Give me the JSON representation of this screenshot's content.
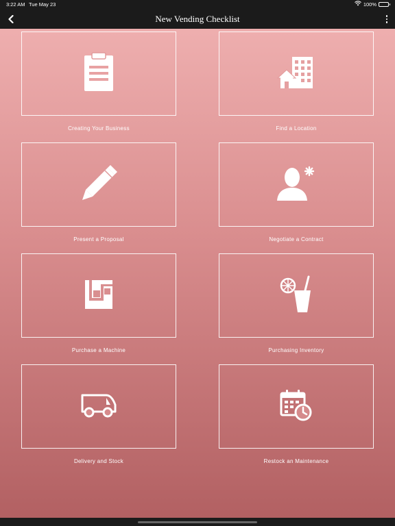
{
  "status_bar": {
    "time": "3:22 AM",
    "date": "Tue May 23",
    "battery": "100%",
    "battery_level": 1.0,
    "icons": [
      "wifi-icon",
      "battery-icon"
    ]
  },
  "nav": {
    "title": "New Vending Checklist",
    "back_icon": "chevron-left-icon",
    "more_icon": "more-vertical-icon"
  },
  "tiles": [
    {
      "label": "Creating Your Business",
      "icon": "clipboard-icon"
    },
    {
      "label": "Find a Location",
      "icon": "buildings-icon"
    },
    {
      "label": "Present a Proposal",
      "icon": "pencil-icon"
    },
    {
      "label": "Negotiate a Contract",
      "icon": "user-icon"
    },
    {
      "label": "Purchase a Machine",
      "icon": "vending-machine-icon"
    },
    {
      "label": "Purchasing Inventory",
      "icon": "drink-icon"
    },
    {
      "label": "Delivery and Stock",
      "icon": "van-icon"
    },
    {
      "label": "Restock an Maintenance",
      "icon": "calendar-clock-icon"
    }
  ],
  "colors": {
    "bar_background": "#1b1b1b",
    "gradient_top": "#f1b3b3",
    "gradient_bottom": "#b15f61",
    "text": "#ffffff"
  }
}
